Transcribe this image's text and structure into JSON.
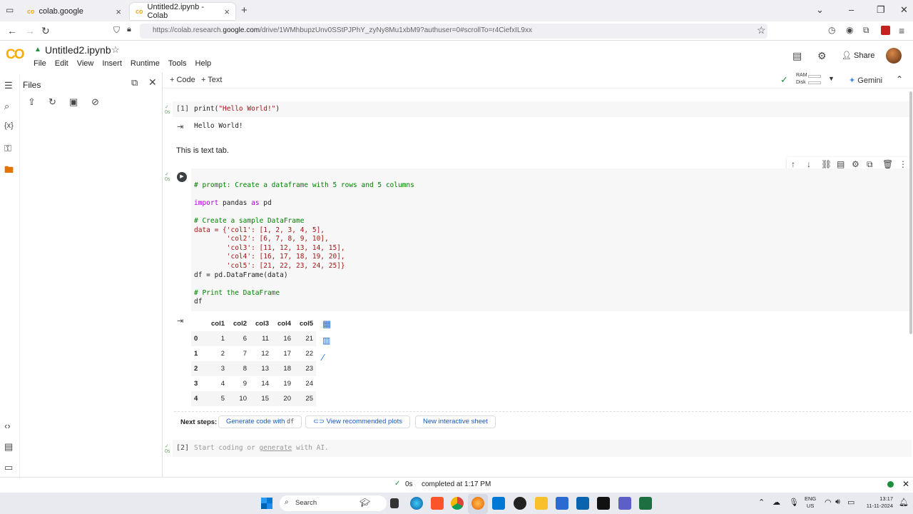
{
  "browser": {
    "tabs": [
      {
        "label": "colab.google",
        "icon": "colab-icon"
      },
      {
        "label": "Untitled2.ipynb - Colab",
        "icon": "colab-icon",
        "active": true
      }
    ],
    "new_tab": "+",
    "url_prefix": "https://colab.research.",
    "url_domain": "google.com",
    "url_rest": "/drive/1WMhbupzUnv0SStPJPhY_zyNy8Mu1xbM9?authuser=0#scrollTo=r4CiefxIL9xx"
  },
  "colab": {
    "logo": "CO",
    "notebook_title": "Untitled2.ipynb",
    "menu": [
      "File",
      "Edit",
      "View",
      "Insert",
      "Runtime",
      "Tools",
      "Help"
    ],
    "share_label": "Share",
    "toolbar": {
      "add_code": "+ Code",
      "add_text": "+ Text",
      "ram": "RAM",
      "disk": "Disk",
      "gemini": "Gemini"
    }
  },
  "sidebar": {
    "files_title": "Files"
  },
  "cells": {
    "cell1": {
      "exec": "[1]",
      "time": "0s",
      "code_fn": "print(",
      "code_str": "\"Hello World!\"",
      "code_end": ")",
      "output": "Hello World!"
    },
    "text_cell": "This is text tab.",
    "cell2": {
      "time": "0s",
      "comment1": "# prompt: Create a dataframe with 5 rows and 5 columns",
      "import_kw": "import",
      "import_mod": " pandas ",
      "as_kw": "as",
      "import_alias": " pd",
      "comment2": "# Create a sample DataFrame",
      "data_lines": [
        "data = {'col1': [1, 2, 3, 4, 5],",
        "        'col2': [6, 7, 8, 9, 10],",
        "        'col3': [11, 12, 13, 14, 15],",
        "        'col4': [16, 17, 18, 19, 20],",
        "        'col5': [21, 22, 23, 24, 25]}"
      ],
      "df_line": "df = pd.DataFrame(data)",
      "comment3": "# Print the DataFrame",
      "last": "df"
    },
    "dataframe": {
      "columns": [
        "col1",
        "col2",
        "col3",
        "col4",
        "col5"
      ],
      "rows": [
        {
          "index": "0",
          "values": [
            "1",
            "6",
            "11",
            "16",
            "21"
          ]
        },
        {
          "index": "1",
          "values": [
            "2",
            "7",
            "12",
            "17",
            "22"
          ]
        },
        {
          "index": "2",
          "values": [
            "3",
            "8",
            "13",
            "18",
            "23"
          ]
        },
        {
          "index": "3",
          "values": [
            "4",
            "9",
            "14",
            "19",
            "24"
          ]
        },
        {
          "index": "4",
          "values": [
            "5",
            "10",
            "15",
            "20",
            "25"
          ]
        }
      ]
    },
    "next_steps": {
      "label": "Next steps:",
      "generate": "Generate code with",
      "generate_code": "df",
      "plots": "View recommended plots",
      "sheet": "New interactive sheet"
    },
    "cell3": {
      "exec": "[2]",
      "time": "0s",
      "placeholder_a": "Start coding or ",
      "placeholder_link": "generate",
      "placeholder_b": " with AI."
    }
  },
  "status": {
    "time": "0s",
    "message": "completed at 1:17 PM"
  },
  "taskbar": {
    "search": "Search",
    "lang": "ENG",
    "region": "US",
    "time": "13:17",
    "date": "11-11-2024"
  }
}
